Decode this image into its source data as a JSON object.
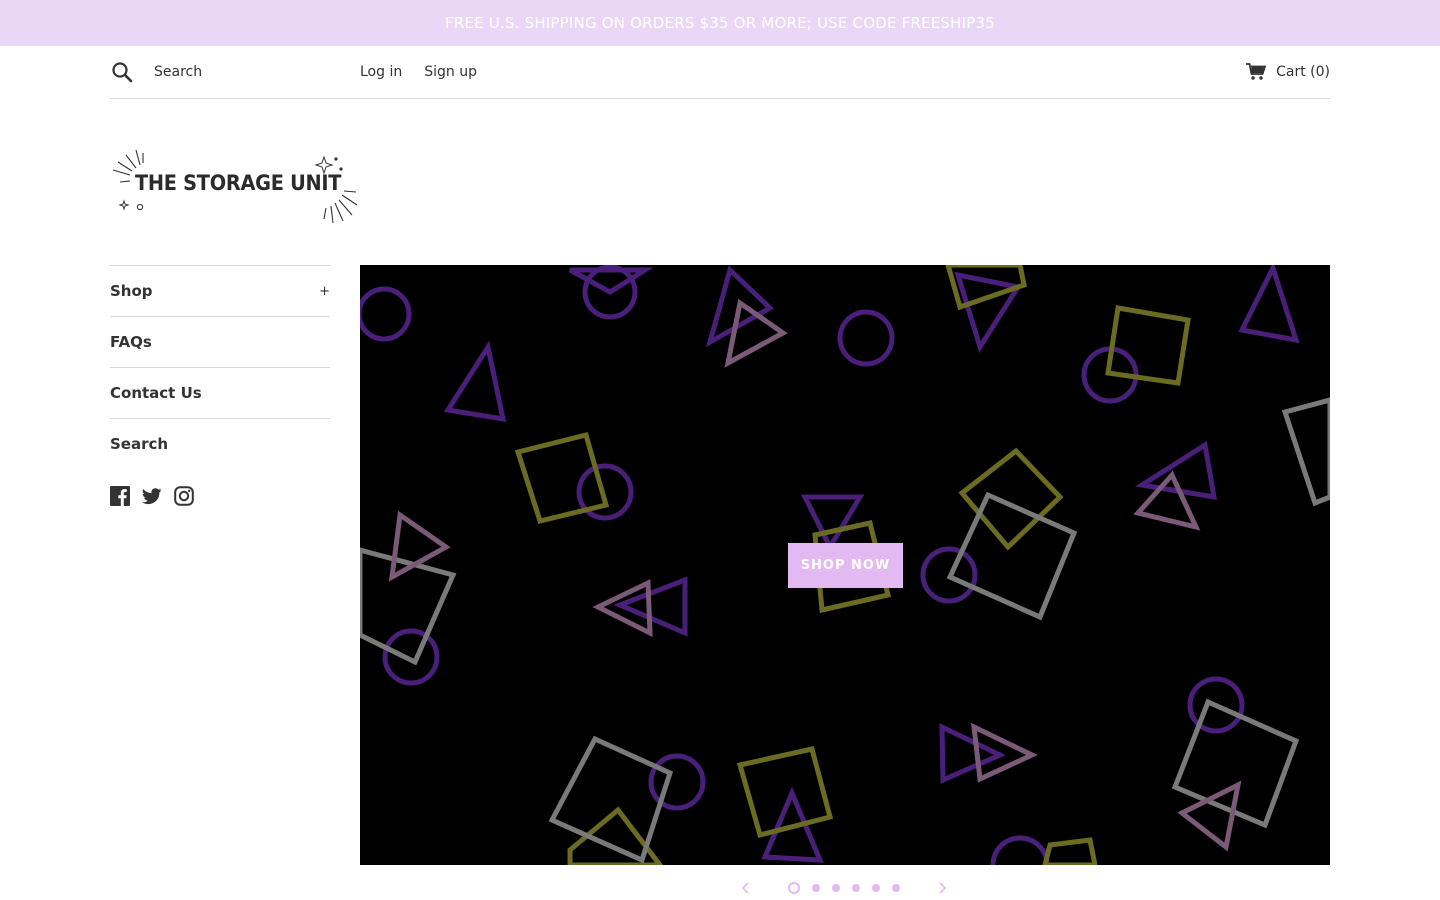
{
  "announcement": {
    "text": "FREE U.S. SHIPPING ON ORDERS $35 OR MORE; USE CODE FREESHIP35"
  },
  "header": {
    "search_placeholder": "Search",
    "login_label": "Log in",
    "signup_label": "Sign up",
    "cart_label": "Cart (0)"
  },
  "logo": {
    "text": "THE STORAGE UNIT"
  },
  "sidebar": {
    "items": [
      {
        "label": "Shop",
        "expand": "+"
      },
      {
        "label": "FAQs"
      },
      {
        "label": "Contact Us"
      },
      {
        "label": "Search"
      }
    ],
    "social": [
      "facebook-icon",
      "twitter-icon",
      "instagram-icon"
    ]
  },
  "hero": {
    "button_label": "SHOP NOW"
  },
  "slider": {
    "slide_count": 6,
    "active_index": 0
  },
  "colors": {
    "announcement_bg": "#ead7f5",
    "accent": "#e2b9f0",
    "purple": "#4a1f7a",
    "olive": "#6b6b22",
    "gray": "#7a7a7a",
    "mauve": "#7b5a78"
  }
}
